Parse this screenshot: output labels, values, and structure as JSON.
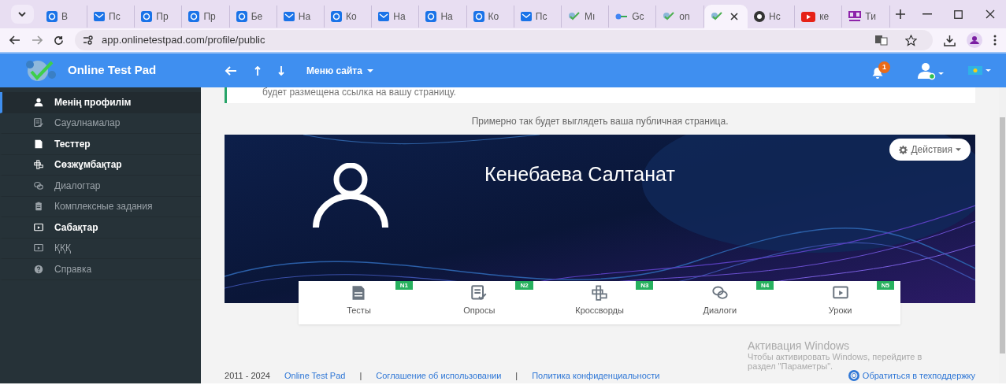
{
  "browser": {
    "tabs": [
      {
        "title": "В",
        "kind": "at",
        "selected": false
      },
      {
        "title": "Пс",
        "kind": "mail",
        "selected": false
      },
      {
        "title": "Пр",
        "kind": "at",
        "selected": false
      },
      {
        "title": "Пр",
        "kind": "at",
        "selected": false
      },
      {
        "title": "Бе",
        "kind": "at",
        "selected": false
      },
      {
        "title": "На",
        "kind": "mail",
        "selected": false
      },
      {
        "title": "Ко",
        "kind": "at",
        "selected": false
      },
      {
        "title": "На",
        "kind": "mail",
        "selected": false
      },
      {
        "title": "На",
        "kind": "at",
        "selected": false
      },
      {
        "title": "Ко",
        "kind": "at",
        "selected": false
      },
      {
        "title": "Пс",
        "kind": "mail",
        "selected": false
      },
      {
        "title": "Мı",
        "kind": "logo",
        "selected": false
      },
      {
        "title": "Gc",
        "kind": "key",
        "selected": false
      },
      {
        "title": "on",
        "kind": "logo",
        "selected": false
      },
      {
        "kind": "logo",
        "selected": true
      },
      {
        "title": "Нс",
        "kind": "chrome",
        "selected": false
      },
      {
        "title": "ке",
        "kind": "video",
        "selected": false
      },
      {
        "title": "Ти",
        "kind": "qr",
        "selected": false
      }
    ],
    "url": "app.onlinetestpad.com/profile/public"
  },
  "navbar": {
    "brand": "Online Test Pad",
    "menu": "Меню сайта",
    "notifications": "1"
  },
  "sidebar": {
    "items": [
      {
        "label": "Менің профилім",
        "kind": "user",
        "selected": true,
        "disabled": false
      },
      {
        "label": "Сауалнамалар",
        "kind": "survey",
        "selected": false,
        "disabled": true
      },
      {
        "label": "Тесттер",
        "kind": "test",
        "selected": false,
        "disabled": false
      },
      {
        "label": "Сөзжұмбақтар",
        "kind": "crossword",
        "selected": false,
        "disabled": false
      },
      {
        "label": "Диалогтар",
        "kind": "dialog",
        "selected": false,
        "disabled": true
      },
      {
        "label": "Комплексные задания",
        "kind": "complex",
        "selected": false,
        "disabled": true
      },
      {
        "label": "Сабақтар",
        "kind": "lesson",
        "selected": false,
        "disabled": false
      },
      {
        "label": "ҚҚҚ",
        "kind": "lesson",
        "selected": false,
        "disabled": true
      },
      {
        "label": "Справка",
        "kind": "help",
        "selected": false,
        "disabled": true
      }
    ]
  },
  "notice": "будет размещена ссылка на вашу страницу.",
  "preview_caption": "Примерно так будет выглядеть ваша публичная страница.",
  "profile": {
    "name": "Кенебаева Салтанат",
    "actions_button": "Действия"
  },
  "sections": [
    {
      "label": "Тесты",
      "badge": "N1",
      "kind": "test"
    },
    {
      "label": "Опросы",
      "badge": "N2",
      "kind": "survey"
    },
    {
      "label": "Кроссворды",
      "badge": "N3",
      "kind": "crossword"
    },
    {
      "label": "Диалоги",
      "badge": "N4",
      "kind": "dialog"
    },
    {
      "label": "Уроки",
      "badge": "N5",
      "kind": "lesson"
    }
  ],
  "footer": [
    {
      "kind": "text",
      "text": "2011 - 2024"
    },
    {
      "kind": "link",
      "text": "Online Test Pad"
    },
    {
      "kind": "separator",
      "text": "|"
    },
    {
      "kind": "link",
      "text": "Соглашение об использовании"
    },
    {
      "kind": "separator",
      "text": "|"
    },
    {
      "kind": "link",
      "text": "Политика конфиденциальности"
    }
  ],
  "support_link": "Обратиться в техподдержку",
  "os_notice": {
    "title": "Активация Windows",
    "lines": [
      "Чтобы активировать Windows, перейдите в",
      "раздел \"Параметры\"."
    ]
  }
}
